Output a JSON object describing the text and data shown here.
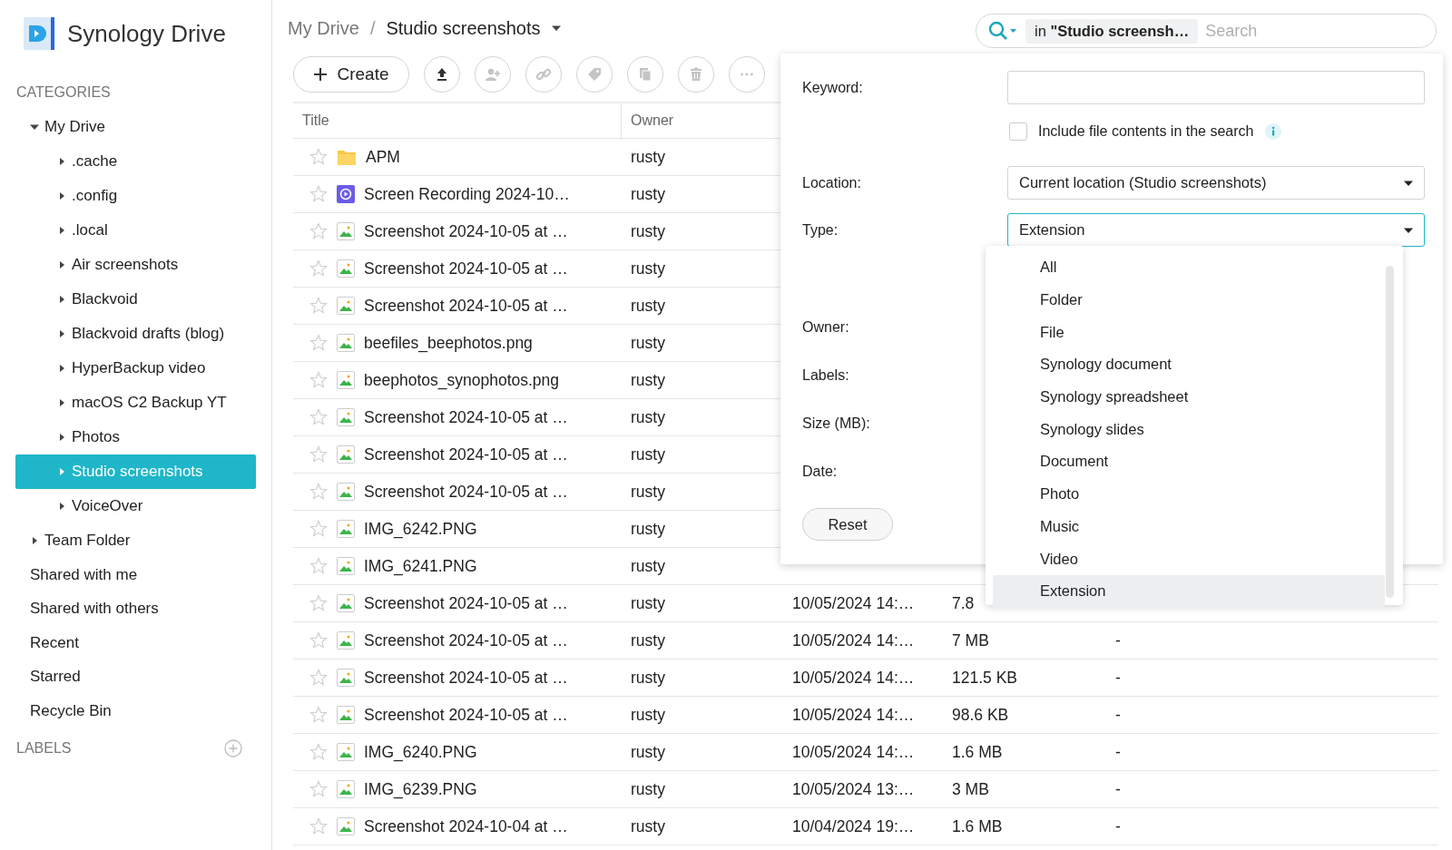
{
  "app": {
    "title": "Synology Drive"
  },
  "sidebar": {
    "categories_heading": "CATEGORIES",
    "tree": [
      {
        "label": "My Drive",
        "expanded": true,
        "selected": false,
        "children": [
          {
            "label": ".cache",
            "expanded": false,
            "selected": false
          },
          {
            "label": ".config",
            "expanded": false,
            "selected": false
          },
          {
            "label": ".local",
            "expanded": false,
            "selected": false
          },
          {
            "label": "Air screenshots",
            "expanded": false,
            "selected": false
          },
          {
            "label": "Blackvoid",
            "expanded": false,
            "selected": false
          },
          {
            "label": "Blackvoid drafts (blog)",
            "expanded": false,
            "selected": false
          },
          {
            "label": "HyperBackup video",
            "expanded": false,
            "selected": false
          },
          {
            "label": "macOS C2 Backup YT",
            "expanded": false,
            "selected": false
          },
          {
            "label": "Photos",
            "expanded": false,
            "selected": false
          },
          {
            "label": "Studio screenshots",
            "expanded": false,
            "selected": true
          },
          {
            "label": "VoiceOver",
            "expanded": false,
            "selected": false
          }
        ]
      },
      {
        "label": "Team Folder",
        "expanded": false,
        "selected": false
      }
    ],
    "items": [
      {
        "label": "Shared with me"
      },
      {
        "label": "Shared with others"
      },
      {
        "label": "Recent"
      },
      {
        "label": "Starred"
      },
      {
        "label": "Recycle Bin"
      }
    ],
    "labels_heading": "LABELS"
  },
  "breadcrumb": {
    "separator": "/",
    "items": [
      {
        "label": "My Drive",
        "current": false
      },
      {
        "label": "Studio screenshots",
        "current": true
      }
    ]
  },
  "toolbar": {
    "create": "Create",
    "buttons": [
      {
        "kind": "upload",
        "disabled": false
      },
      {
        "kind": "share",
        "disabled": true
      },
      {
        "kind": "link",
        "disabled": true
      },
      {
        "kind": "tag",
        "disabled": true
      },
      {
        "kind": "copy",
        "disabled": true
      },
      {
        "kind": "delete",
        "disabled": true
      },
      {
        "kind": "more",
        "disabled": true
      }
    ]
  },
  "search": {
    "scope": "in **\"Studio screensh…**",
    "placeholder": "Search"
  },
  "table": {
    "columns": [
      "Title",
      "Owner"
    ],
    "rows": [
      {
        "kind": "folder",
        "starred": false,
        "title": "APM",
        "owner": "rusty"
      },
      {
        "kind": "video",
        "starred": false,
        "title": "Screen Recording 2024-10…",
        "owner": "rusty"
      },
      {
        "kind": "image",
        "starred": false,
        "title": "Screenshot 2024-10-05 at …",
        "owner": "rusty"
      },
      {
        "kind": "image",
        "starred": false,
        "title": "Screenshot 2024-10-05 at …",
        "owner": "rusty"
      },
      {
        "kind": "image",
        "starred": false,
        "title": "Screenshot 2024-10-05 at …",
        "owner": "rusty"
      },
      {
        "kind": "image",
        "starred": false,
        "title": "beefiles_beephotos.png",
        "owner": "rusty"
      },
      {
        "kind": "image",
        "starred": false,
        "title": "beephotos_synophotos.png",
        "owner": "rusty"
      },
      {
        "kind": "image",
        "starred": false,
        "title": "Screenshot 2024-10-05 at …",
        "owner": "rusty"
      },
      {
        "kind": "image",
        "starred": false,
        "title": "Screenshot 2024-10-05 at …",
        "owner": "rusty"
      },
      {
        "kind": "image",
        "starred": false,
        "title": "Screenshot 2024-10-05 at …",
        "owner": "rusty"
      },
      {
        "kind": "image",
        "starred": false,
        "title": "IMG_6242.PNG",
        "owner": "rusty"
      },
      {
        "kind": "image",
        "starred": false,
        "title": "IMG_6241.PNG",
        "owner": "rusty"
      },
      {
        "kind": "image",
        "starred": false,
        "title": "Screenshot 2024-10-05 at …",
        "owner": "rusty",
        "modified": "10/05/2024 14:…",
        "size": "7.8"
      },
      {
        "kind": "image",
        "starred": false,
        "title": "Screenshot 2024-10-05 at …",
        "owner": "rusty",
        "modified": "10/05/2024 14:…",
        "size": "7 MB",
        "column_5": "-"
      },
      {
        "kind": "image",
        "starred": false,
        "title": "Screenshot 2024-10-05 at …",
        "owner": "rusty",
        "modified": "10/05/2024 14:…",
        "size": "121.5 KB",
        "column_5": "-"
      },
      {
        "kind": "image",
        "starred": false,
        "title": "Screenshot 2024-10-05 at …",
        "owner": "rusty",
        "modified": "10/05/2024 14:…",
        "size": "98.6 KB",
        "column_5": "-"
      },
      {
        "kind": "image",
        "starred": false,
        "title": "IMG_6240.PNG",
        "owner": "rusty",
        "modified": "10/05/2024 14:…",
        "size": "1.6 MB",
        "column_5": "-"
      },
      {
        "kind": "image",
        "starred": false,
        "title": "IMG_6239.PNG",
        "owner": "rusty",
        "modified": "10/05/2024 13:…",
        "size": "3 MB",
        "column_5": "-"
      },
      {
        "kind": "image",
        "starred": false,
        "title": "Screenshot 2024-10-04 at …",
        "owner": "rusty",
        "modified": "10/04/2024 19:…",
        "size": "1.6 MB",
        "column_5": "-"
      }
    ]
  },
  "search_panel": {
    "keyword_label": "Keyword:",
    "include_contents": {
      "label": "Include file contents in the search",
      "checked": false
    },
    "location": {
      "label": "Location:",
      "value": "Current location (Studio screenshots)"
    },
    "type": {
      "label": "Type:",
      "value": "Extension",
      "options": [
        {
          "label": "All",
          "selected": false
        },
        {
          "label": "Folder",
          "selected": false
        },
        {
          "label": "File",
          "selected": false
        },
        {
          "label": "Synology document",
          "selected": false
        },
        {
          "label": "Synology spreadsheet",
          "selected": false
        },
        {
          "label": "Synology slides",
          "selected": false
        },
        {
          "label": "Document",
          "selected": false
        },
        {
          "label": "Photo",
          "selected": false
        },
        {
          "label": "Music",
          "selected": false
        },
        {
          "label": "Video",
          "selected": false
        },
        {
          "label": "Extension",
          "selected": true
        }
      ]
    },
    "other_labels": [
      "Owner:",
      "Labels:",
      "Size (MB):",
      "Date:"
    ],
    "reset": "Reset"
  }
}
